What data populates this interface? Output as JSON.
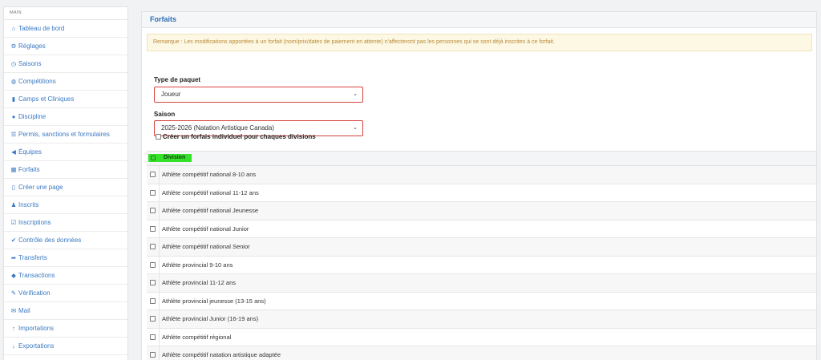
{
  "sidebar": {
    "heading": "MAIN",
    "items": [
      {
        "label": "Tableau de bord",
        "icon": "home-icon",
        "glyph": "⌂"
      },
      {
        "label": "Réglages",
        "icon": "gear-icon",
        "glyph": "⚙"
      },
      {
        "label": "Saisons",
        "icon": "clock-icon",
        "glyph": "◷"
      },
      {
        "label": "Compétitions",
        "icon": "globe-icon",
        "glyph": "◍"
      },
      {
        "label": "Camps et Cliniques",
        "icon": "book-icon",
        "glyph": "▮"
      },
      {
        "label": "Discipline",
        "icon": "info-icon",
        "glyph": "●"
      },
      {
        "label": "Permis, sanctions et formulaires",
        "icon": "list-icon",
        "glyph": "☰"
      },
      {
        "label": "Équipes",
        "icon": "megaphone-icon",
        "glyph": "◀"
      },
      {
        "label": "Forfaits",
        "icon": "grid-icon",
        "glyph": "▦"
      },
      {
        "label": "Créer une page",
        "icon": "file-icon",
        "glyph": "▯"
      },
      {
        "label": "Inscrits",
        "icon": "user-icon",
        "glyph": "♟"
      },
      {
        "label": "Inscriptions",
        "icon": "check-square-icon",
        "glyph": "☑"
      },
      {
        "label": "Contrôle des données",
        "icon": "check-circle-icon",
        "glyph": "✔"
      },
      {
        "label": "Transferts",
        "icon": "share-icon",
        "glyph": "➦"
      },
      {
        "label": "Transactions",
        "icon": "tags-icon",
        "glyph": "◆"
      },
      {
        "label": "Vérification",
        "icon": "pencil-icon",
        "glyph": "✎"
      },
      {
        "label": "Mail",
        "icon": "envelope-icon",
        "glyph": "✉"
      },
      {
        "label": "Importations",
        "icon": "arrow-up-icon",
        "glyph": "↑"
      },
      {
        "label": "Exportations",
        "icon": "arrow-down-icon",
        "glyph": "↓"
      }
    ]
  },
  "panel": {
    "title": "Forfaits",
    "notice": "Remarque : Les modifications apportées à un forfait (nom/prix/dates de paiement en attente) n'affecteront pas les personnes qui se sont déjà inscrites à ce forfait.",
    "package_type": {
      "label": "Type de paquet",
      "value": "Joueur"
    },
    "season": {
      "label": "Saison",
      "value": "2025-2026 (Natation Artistique Canada)"
    },
    "individual_checkbox_label": "Créer un forfais individuel pour chaques divisions",
    "table": {
      "header": "Division",
      "rows": [
        "Athlète compétitif national 8-10 ans",
        "Athlète compétitif national 11-12 ans",
        "Athlète compétitif national Jeunesse",
        "Athlète compétitif national Junior",
        "Athlète compétitif national Senior",
        "Athlète provincial 9-10 ans",
        "Athlète provincial 11-12 ans",
        "Athlète provincial jeunesse (13-15 ans)",
        "Athlète provincial Junior (16-19 ans)",
        "Athlète compétitif régional",
        "Athlète compétitif natation artistique adaptée"
      ]
    }
  },
  "colors": {
    "link": "#3c7ac2",
    "highlight": "#36e12a",
    "notice_text": "#bd8a3a",
    "select_border": "#d6453d"
  }
}
